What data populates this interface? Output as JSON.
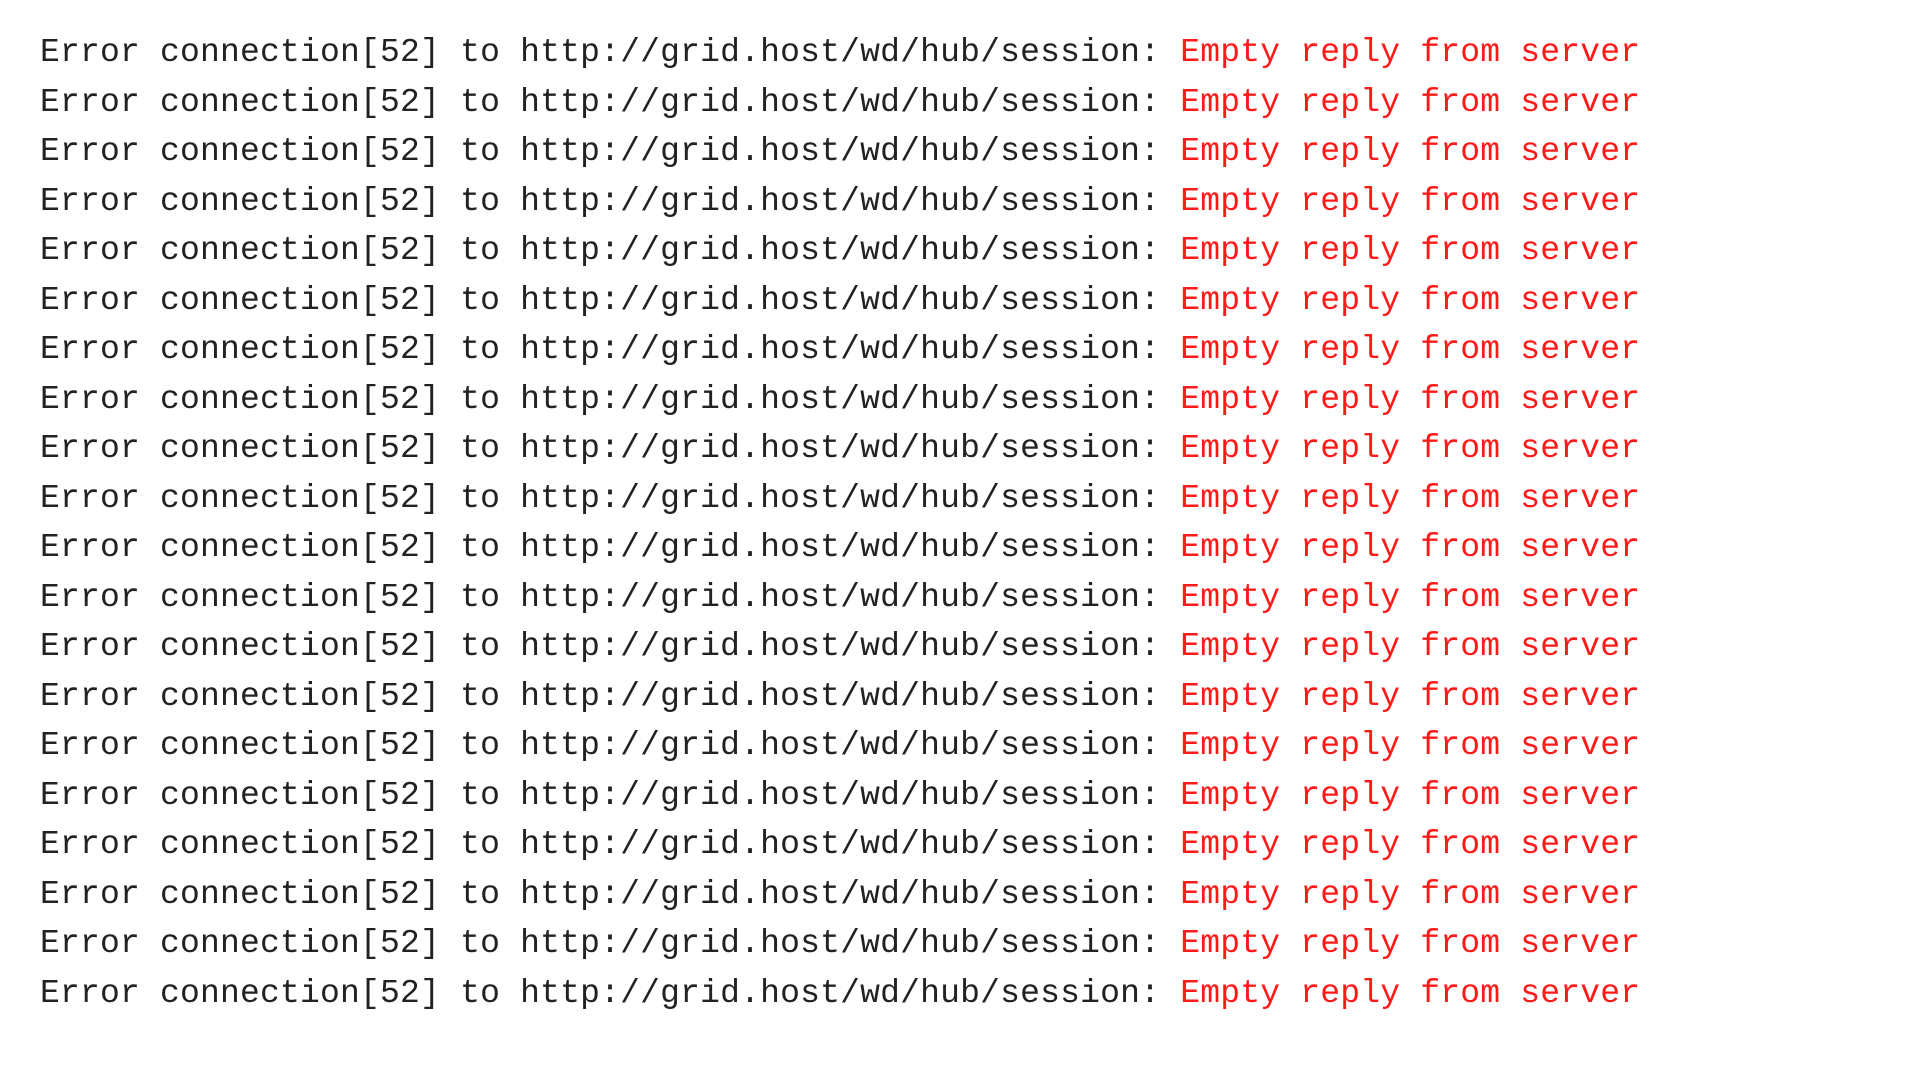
{
  "log": {
    "prefix": "Error connection[52] to http://grid.host/wd/hub/session: ",
    "error_message": "Empty reply from server",
    "line_count": 20,
    "colors": {
      "text": "#222222",
      "error": "#ff1a1a",
      "background": "#ffffff"
    }
  }
}
